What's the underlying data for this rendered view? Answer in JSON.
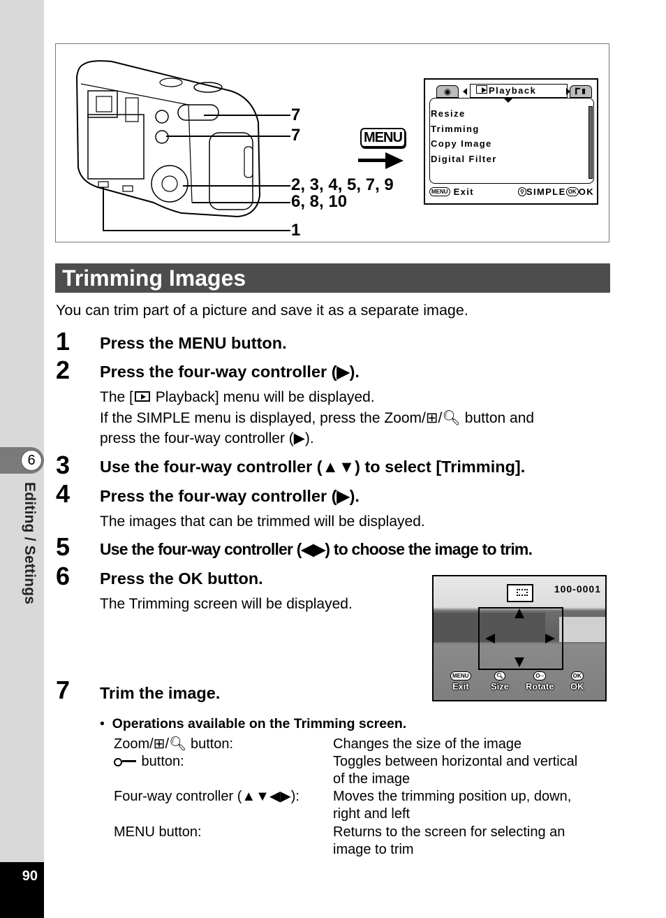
{
  "sidebar": {
    "chapter_number": "6",
    "chapter_title": "Editing / Settings",
    "page_number": "90"
  },
  "figure": {
    "callouts": [
      "7",
      "7",
      "2, 3, 4, 5, 7, 9",
      "6, 8, 10",
      "1"
    ],
    "menu_key_label": "MENU",
    "lcd": {
      "tab_active": "Playback",
      "tab_left_icon": "camera-icon",
      "tab_right_icon": "wrench-settings-icon",
      "items": [
        "Resize",
        "Trimming",
        "Copy Image",
        "Digital Filter"
      ],
      "footer_left_key": "MENU",
      "footer_left_label": "Exit",
      "footer_mid_label": "SIMPLE",
      "footer_right_key": "OK",
      "footer_right_label": "OK"
    }
  },
  "section": {
    "title": "Trimming Images",
    "intro": "You can trim part of a picture and save it as a separate image."
  },
  "steps": [
    {
      "num": "1",
      "head": "Press the MENU button."
    },
    {
      "num": "2",
      "head": "Press the four-way controller (▶).",
      "body1_pre": "The [",
      "body1_post": " Playback] menu will be displayed.",
      "body2": "If the SIMPLE menu is displayed, press the Zoom/⊞/🔍︎ button and",
      "body3": "press the four-way controller (▶)."
    },
    {
      "num": "3",
      "head": "Use the four-way controller (▲▼) to select [Trimming]."
    },
    {
      "num": "4",
      "head": "Press the four-way controller (▶).",
      "body": "The images that can be trimmed will be displayed."
    },
    {
      "num": "5",
      "head": "Use the four-way controller (◀▶) to choose the image to trim."
    },
    {
      "num": "6",
      "head": "Press the OK button.",
      "body": "The Trimming screen will be displayed."
    },
    {
      "num": "7",
      "head": "Trim the image."
    }
  ],
  "trim_screen": {
    "file_number": "100-0001",
    "controls": [
      {
        "key": "MENU",
        "label": "Exit"
      },
      {
        "key": "🔍︎",
        "label": "Size"
      },
      {
        "key": "O─",
        "label": "Rotate"
      },
      {
        "key": "OK",
        "label": "OK"
      }
    ]
  },
  "operations": {
    "bullet": "•",
    "heading": "Operations available on the Trimming screen.",
    "rows": [
      {
        "control": "Zoom/⊞/🔍︎ button:",
        "desc": [
          "Changes the size of the image"
        ]
      },
      {
        "control": " button:",
        "desc": [
          "Toggles between horizontal and vertical",
          "of the image"
        ]
      },
      {
        "control": "Four-way controller (▲▼◀▶):",
        "desc": [
          "Moves the trimming position up, down,",
          "right and left"
        ]
      },
      {
        "control": "MENU button:",
        "desc": [
          "Returns to the screen for selecting an",
          "image to trim"
        ]
      }
    ]
  }
}
